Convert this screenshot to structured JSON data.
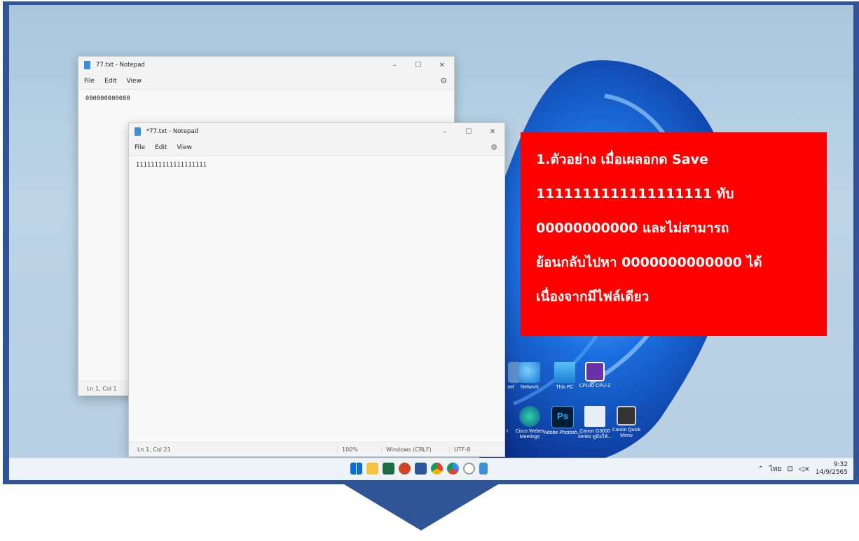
{
  "notepad_back": {
    "title": "77.txt - Notepad",
    "menu": [
      "File",
      "Edit",
      "View"
    ],
    "content": "000000000000",
    "status_pos": "Ln 1, Col 1"
  },
  "notepad_front": {
    "title": "*77.txt - Notepad",
    "menu": [
      "File",
      "Edit",
      "View"
    ],
    "content": "1111111111111111111",
    "status_pos": "Ln 1, Col 21",
    "zoom": "100%",
    "line_ending": "Windows (CRLF)",
    "encoding": "UTF-8"
  },
  "desktop_icons": [
    {
      "label": "nel",
      "icon": "control-panel-icon"
    },
    {
      "label": "Network",
      "icon": "network-icon"
    },
    {
      "label": "This PC",
      "icon": "this-pc-icon"
    },
    {
      "label": "CPUID CPU-Z",
      "icon": "cpu-z-icon"
    },
    {
      "label": "t",
      "icon": "app-icon"
    },
    {
      "label": "Cisco Webex Meetings",
      "icon": "webex-icon"
    },
    {
      "label": "Adobe Photosh...",
      "icon": "photoshop-icon"
    },
    {
      "label": "Canon G3000 series คู่มือใช้...",
      "icon": "canon-manual-icon"
    },
    {
      "label": "Canon Quick Menu",
      "icon": "canon-quick-menu-icon"
    }
  ],
  "callout": {
    "lines": [
      "1.ตัวอย่าง เมื่อเผลอกด Save",
      "1111111111111111111 ทับ",
      "00000000000 และไม่สามารถ",
      "ย้อนกลับไปหา 0000000000000 ได้",
      "เนื่องจากมีไฟล์เดียว"
    ]
  },
  "taskbar": {
    "icons": [
      "windows-start-icon",
      "file-explorer-icon",
      "excel-icon",
      "powerpoint-icon",
      "word-icon",
      "chrome-icon",
      "chrome-beta-icon",
      "clock-app-icon",
      "notepad-icon"
    ],
    "tray_lang": "ไทย",
    "time": "9:32",
    "date": "14/9/2565"
  },
  "colors": {
    "frame": "#2f5597",
    "callout": "#ff0000"
  }
}
